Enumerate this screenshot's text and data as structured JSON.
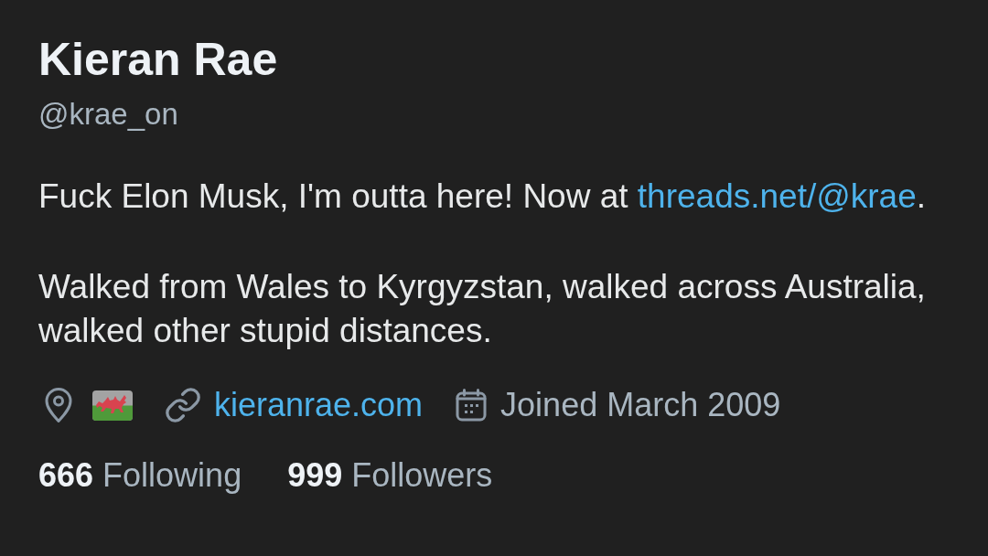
{
  "profile": {
    "name": "Kieran Rae",
    "handle": "@krae_on"
  },
  "bio": [
    {
      "parts": [
        {
          "kind": "text",
          "text": "Fuck Elon Musk, I'm outta here! Now at "
        },
        {
          "kind": "link",
          "text": "threads.net/@krae"
        },
        {
          "kind": "text",
          "text": "."
        }
      ]
    },
    {
      "parts": [
        {
          "kind": "text",
          "text": "Walked from Wales to Kyrgyzstan, walked across Australia, walked other stupid distances."
        }
      ]
    }
  ],
  "meta": [
    {
      "kind": "location"
    },
    {
      "kind": "website",
      "text": "kieranrae.com"
    },
    {
      "kind": "joined",
      "text": "Joined March 2009"
    }
  ],
  "stats": [
    {
      "count": "666",
      "label": "Following"
    },
    {
      "count": "999",
      "label": "Followers"
    }
  ]
}
